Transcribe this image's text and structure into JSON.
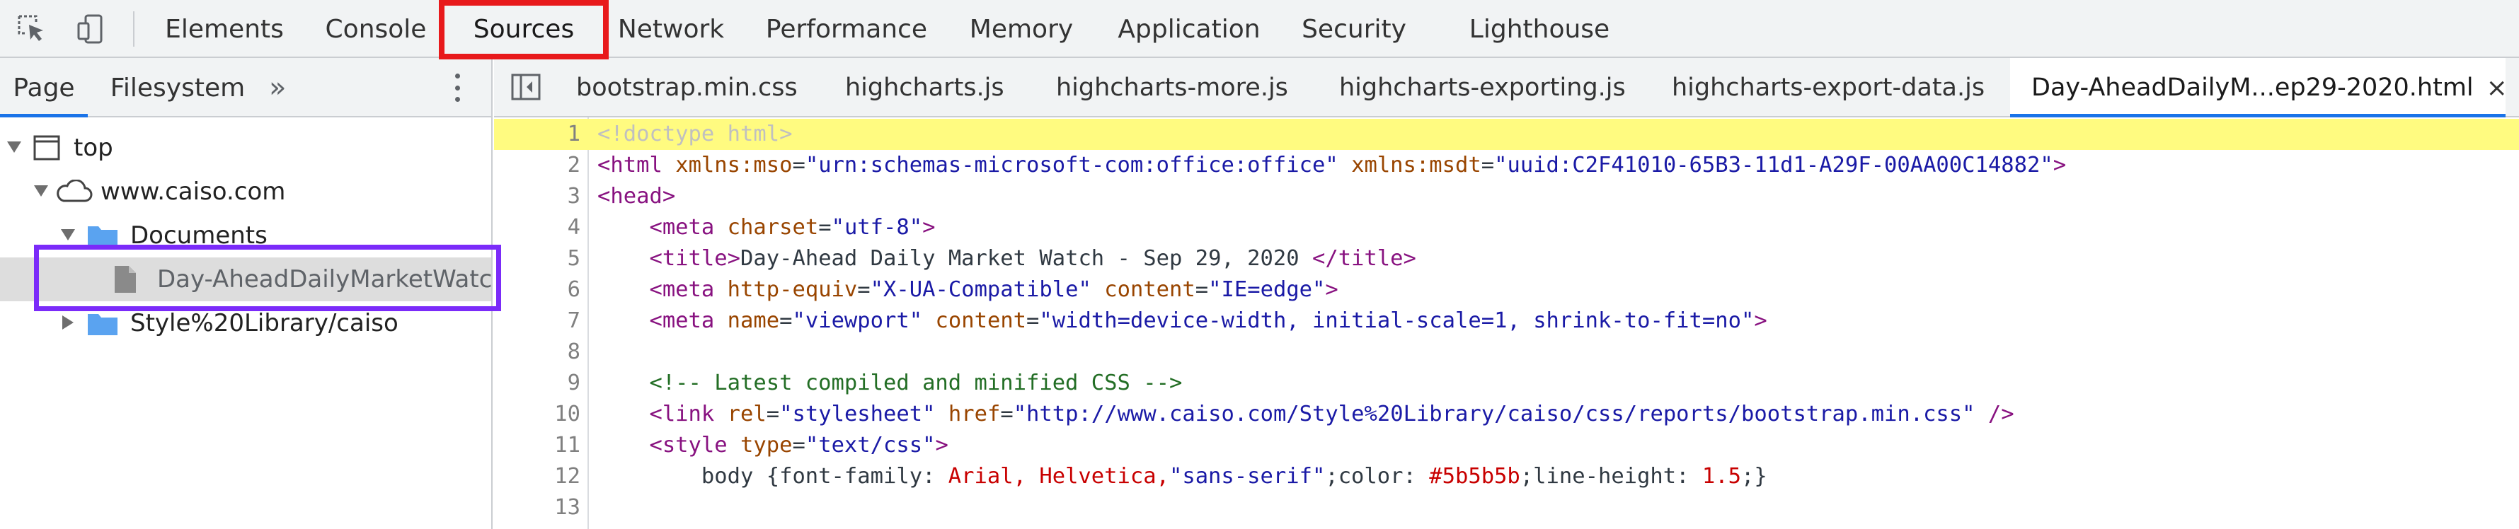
{
  "toolbar": {
    "inspect_icon": "inspect-element-icon",
    "device_icon": "device-toolbar-icon",
    "tabs": [
      {
        "label": "Elements",
        "active": false
      },
      {
        "label": "Console",
        "active": false
      },
      {
        "label": "Sources",
        "active": true
      },
      {
        "label": "Network",
        "active": false
      },
      {
        "label": "Performance",
        "active": false
      },
      {
        "label": "Memory",
        "active": false
      },
      {
        "label": "Application",
        "active": false
      },
      {
        "label": "Security",
        "active": false
      },
      {
        "label": "Lighthouse",
        "active": false
      }
    ]
  },
  "navigator": {
    "tabs": [
      {
        "label": "Page",
        "active": true
      },
      {
        "label": "Filesystem",
        "active": false
      }
    ],
    "more_label": "»",
    "tree": [
      {
        "label": "top",
        "icon": "frame-icon",
        "expanded": true
      },
      {
        "label": "www.caiso.com",
        "icon": "cloud-icon",
        "expanded": true
      },
      {
        "label": "Documents",
        "icon": "folder-icon",
        "expanded": true
      },
      {
        "label": "Day-AheadDailyMarketWatch",
        "icon": "document-icon",
        "selected": true
      },
      {
        "label": "Style%20Library/caiso",
        "icon": "folder-icon",
        "expanded": false
      }
    ]
  },
  "editor": {
    "tabs": [
      {
        "label": "bootstrap.min.css",
        "active": false
      },
      {
        "label": "highcharts.js",
        "active": false
      },
      {
        "label": "highcharts-more.js",
        "active": false
      },
      {
        "label": "highcharts-exporting.js",
        "active": false
      },
      {
        "label": "highcharts-export-data.js",
        "active": false
      },
      {
        "label": "Day-AheadDailyM...ep29-2020.html",
        "active": true
      }
    ],
    "close_symbol": "×",
    "current_line": 1,
    "lines": [
      {
        "n": "1",
        "text": "<!doctype html>"
      },
      {
        "n": "2",
        "text": "<html xmlns:mso=\"urn:schemas-microsoft-com:office:office\" xmlns:msdt=\"uuid:C2F41010-65B3-11d1-A29F-00AA00C14882\">"
      },
      {
        "n": "3",
        "text": "<head>"
      },
      {
        "n": "4",
        "text": "    <meta charset=\"utf-8\">"
      },
      {
        "n": "5",
        "text": "    <title>Day-Ahead Daily Market Watch - Sep 29, 2020 </title>"
      },
      {
        "n": "6",
        "text": "    <meta http-equiv=\"X-UA-Compatible\" content=\"IE=edge\">"
      },
      {
        "n": "7",
        "text": "    <meta name=\"viewport\" content=\"width=device-width, initial-scale=1, shrink-to-fit=no\">"
      },
      {
        "n": "8",
        "text": ""
      },
      {
        "n": "9",
        "text": "    <!-- Latest compiled and minified CSS -->"
      },
      {
        "n": "10",
        "text": "    <link rel=\"stylesheet\" href=\"http://www.caiso.com/Style%20Library/caiso/css/reports/bootstrap.min.css\" />"
      },
      {
        "n": "11",
        "text": "    <style type=\"text/css\">"
      },
      {
        "n": "12",
        "text": "        body {font-family: Arial, Helvetica,\"sans-serif\";color: #5b5b5b;line-height: 1.5;}"
      },
      {
        "n": "13",
        "text": ""
      }
    ]
  },
  "colors": {
    "accent": "#1a73e8",
    "highlight_red": "#e8191b",
    "highlight_purple": "#7b2bf9",
    "current_line": "#fffb80",
    "tag": "#881280",
    "attribute": "#994500",
    "value": "#1a1aa6",
    "comment": "#236e25"
  }
}
